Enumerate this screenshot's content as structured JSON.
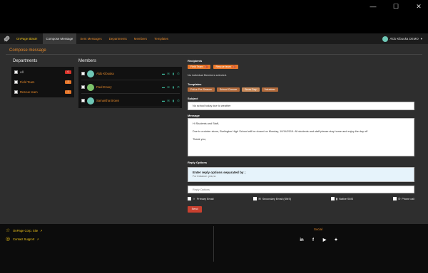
{
  "window": {
    "minimize": "—",
    "maximize": "☐",
    "close": "✕"
  },
  "nav": {
    "brand": "OnPage Blast!!",
    "tabs": [
      "Compose Message",
      "Sent Messages",
      "Departments",
      "Members",
      "Templates"
    ],
    "user": "Aldo Kibuuka DEMO"
  },
  "page_title": "Compose message",
  "departments": {
    "heading": "Departments",
    "items": [
      {
        "label": "All",
        "count": "0",
        "color": "#d9342b"
      },
      {
        "label": "Field Team",
        "count": "2",
        "color": "#e8772a"
      },
      {
        "label": "Rescue team",
        "count": "1",
        "color": "#e8772a"
      }
    ]
  },
  "members": {
    "heading": "Members",
    "items": [
      {
        "name": "Aldo Kibuuka",
        "avatar_color": "#6fc7b6"
      },
      {
        "name": "Paul Emery",
        "avatar_color": "#7cc36a"
      },
      {
        "name": "Samantha Brown",
        "avatar_color": "#6fc7b6"
      }
    ],
    "icons": [
      "message-icon",
      "email-icon",
      "mobile-icon",
      "phone-icon"
    ]
  },
  "form": {
    "recipients_label": "Recipients",
    "recipients": [
      "Field Team",
      "Rescue team"
    ],
    "no_individual": "No individual Members selected.",
    "templates_label": "Templates",
    "templates": [
      "Police Pre-Season",
      "School Closure",
      "Snow Day",
      "Volunteer"
    ],
    "subject_label": "Subject",
    "subject_value": "No school today due to weather",
    "message_label": "Message",
    "message_lines": [
      "Hi Students and Staff,",
      "Due to a winter storm, Burlington High School will be closed on Monday, 10/14/2019. All students and staff please stay home and enjoy the day off",
      "Thank you,"
    ],
    "reply_label": "Reply Options",
    "reply_hint_title": "Enter reply options separated by ;",
    "reply_hint_sub": "For Instance: yes;no",
    "reply_placeholder": "Reply Options",
    "delivery": [
      "Primary Email",
      "Secondary Email (SMS)",
      "Native SMS",
      "Phone call"
    ],
    "send_label": "Send"
  },
  "footer": {
    "link1": "OnPage Corp. Site",
    "link2": "Contact Support",
    "social_heading": "Social",
    "social_icons": [
      "linkedin-icon",
      "facebook-icon",
      "youtube-icon",
      "twitter-icon"
    ]
  }
}
